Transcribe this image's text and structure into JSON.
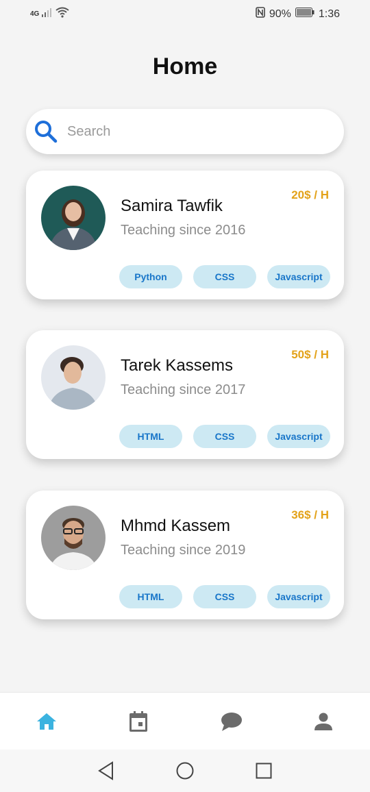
{
  "status_bar": {
    "network": "4G",
    "battery": "90%",
    "time": "1:36"
  },
  "page": {
    "title": "Home"
  },
  "search": {
    "placeholder": "Search",
    "icon": "search-icon"
  },
  "tutors": [
    {
      "name": "Samira Tawfik",
      "since": "Teaching since 2016",
      "price": "20$ / H",
      "tags": [
        "Python",
        "CSS",
        "Javascript"
      ]
    },
    {
      "name": "Tarek Kassems",
      "since": "Teaching since 2017",
      "price": "50$ / H",
      "tags": [
        "HTML",
        "CSS",
        "Javascript"
      ]
    },
    {
      "name": "Mhmd Kassem",
      "since": "Teaching since 2019",
      "price": "36$ / H",
      "tags": [
        "HTML",
        "CSS",
        "Javascript"
      ]
    }
  ],
  "bottom_nav": {
    "items": [
      "home-icon",
      "calendar-icon",
      "chat-icon",
      "person-icon"
    ],
    "active": "home-icon",
    "active_color": "#3bb3e0",
    "inactive_color": "#6b6b6b"
  },
  "colors": {
    "price": "#e3a21a",
    "tag_bg": "#cde9f3",
    "tag_text": "#1976c9",
    "search_icon": "#1e6fd9"
  }
}
